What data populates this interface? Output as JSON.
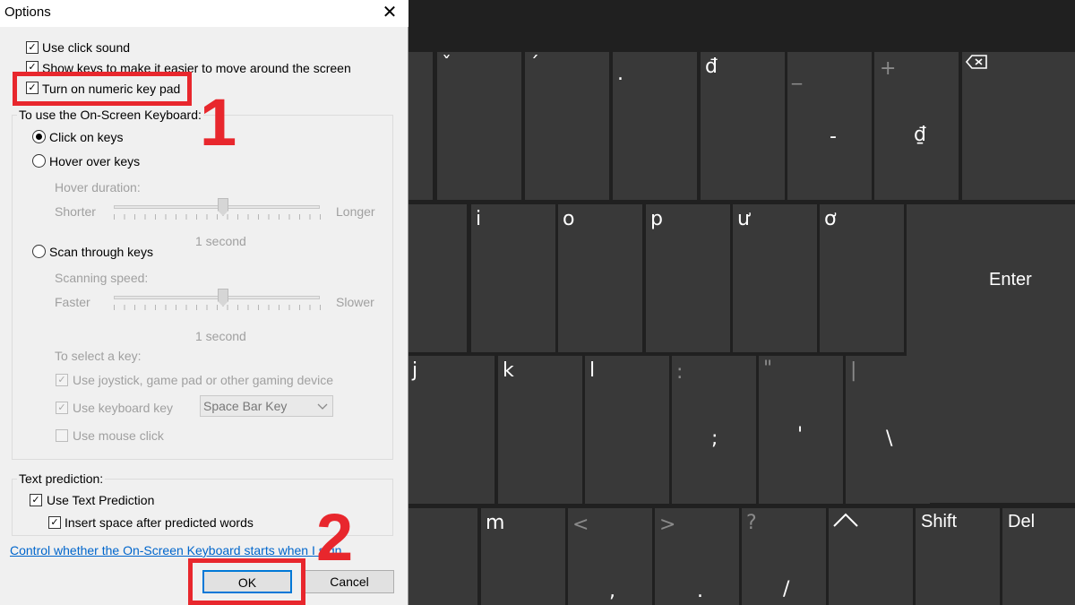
{
  "dialog": {
    "title": "Options",
    "close_glyph": "✕",
    "use_click_sound": "Use click sound",
    "show_keys": "Show keys to make it easier to move around the screen",
    "numeric_keypad": "Turn on numeric key pad",
    "osk_group": {
      "label": "To use the On-Screen Keyboard:",
      "click_on_keys": "Click on keys",
      "hover_over_keys": "Hover over keys",
      "hover_duration": "Hover duration:",
      "hover_min": "Shorter",
      "hover_max": "Longer",
      "hover_value": "1 second",
      "scan_through_keys": "Scan through keys",
      "scanning_speed": "Scanning speed:",
      "scan_min": "Faster",
      "scan_max": "Slower",
      "scan_value": "1 second",
      "to_select_key": "To select a key:",
      "use_joystick": "Use joystick, game pad or other gaming device",
      "use_keyboard_key": "Use keyboard key",
      "keyboard_key_value": "Space Bar Key",
      "use_mouse_click": "Use mouse click",
      "selected_mode": "click_on_keys",
      "hover_slider_level": 0.5,
      "scan_slider_level": 0.5
    },
    "text_prediction": {
      "label": "Text prediction:",
      "use_text_prediction": "Use Text Prediction",
      "insert_space": "Insert space after predicted words"
    },
    "startup_link": "Control whether the On-Screen Keyboard starts when I sign in",
    "ok": "OK",
    "cancel": "Cancel"
  },
  "annotations": {
    "step1": "1",
    "step2": "2",
    "color": "#e8272d"
  },
  "keyboard": {
    "row1": {
      "k1": "ˇ",
      "k2": "´",
      "k3": ".",
      "k4": "đ",
      "k5_top": "_",
      "k5_bottom": "-",
      "k6_top": "+",
      "k6_bottom": "₫",
      "backspace_icon": "backspace-icon"
    },
    "row2": [
      "i",
      "o",
      "p",
      "ư",
      "ơ"
    ],
    "enter": "Enter",
    "row3": {
      "k1": "j",
      "k2": "k",
      "k3": "l",
      "k4_top": ":",
      "k4_bottom": ";",
      "k5_top": "\"",
      "k5_bottom": "'",
      "k6_top": "|",
      "k6_bottom": "\\"
    },
    "row4": {
      "k2": "m",
      "k3_top": "<",
      "k3_bottom": ",",
      "k4_top": ">",
      "k4_bottom": ".",
      "k5_top": "?",
      "k5_bottom": "/",
      "shift": "Shift",
      "del": "Del"
    }
  }
}
